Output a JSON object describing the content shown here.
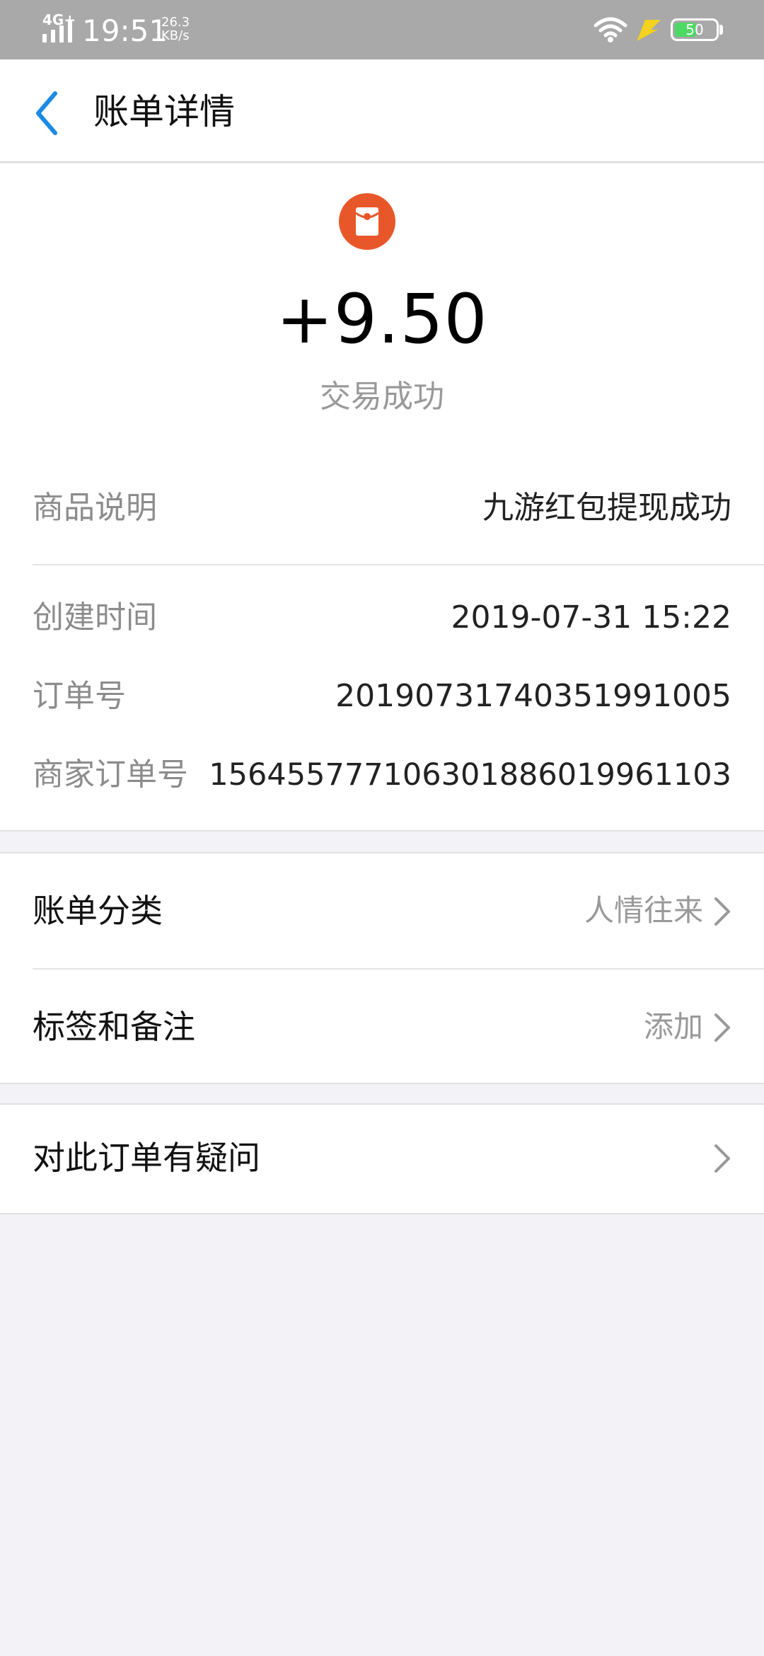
{
  "status_bar": {
    "network": "4G+",
    "time": "19:51",
    "speed_value": "26.3",
    "speed_unit": "KB/s",
    "battery": "50",
    "icons": [
      "signal-icon",
      "wifi-icon",
      "charging-icon",
      "battery-icon"
    ]
  },
  "header": {
    "title": "账单详情",
    "back_icon": "chevron-left-icon"
  },
  "summary": {
    "icon": "red-packet-icon",
    "amount": "+9.50",
    "status": "交易成功"
  },
  "details": [
    {
      "label": "商品说明",
      "value": "九游红包提现成功"
    },
    {
      "label": "创建时间",
      "value": "2019-07-31 15:22"
    },
    {
      "label": "订单号",
      "value": "20190731740351991005"
    },
    {
      "label": "商家订单号",
      "value": "1564557771063018860199611​03"
    }
  ],
  "actions": [
    {
      "label": "账单分类",
      "value": "人情往来"
    },
    {
      "label": "标签和备注",
      "value": "添加"
    }
  ],
  "help": {
    "label": "对此订单有疑问"
  },
  "colors": {
    "accent_blue": "#1a8ae5",
    "red_packet": "#e8572a",
    "battery_green": "#4cd964",
    "status_bar": "#a9a9a9",
    "page_bg": "#f2f2f7"
  }
}
